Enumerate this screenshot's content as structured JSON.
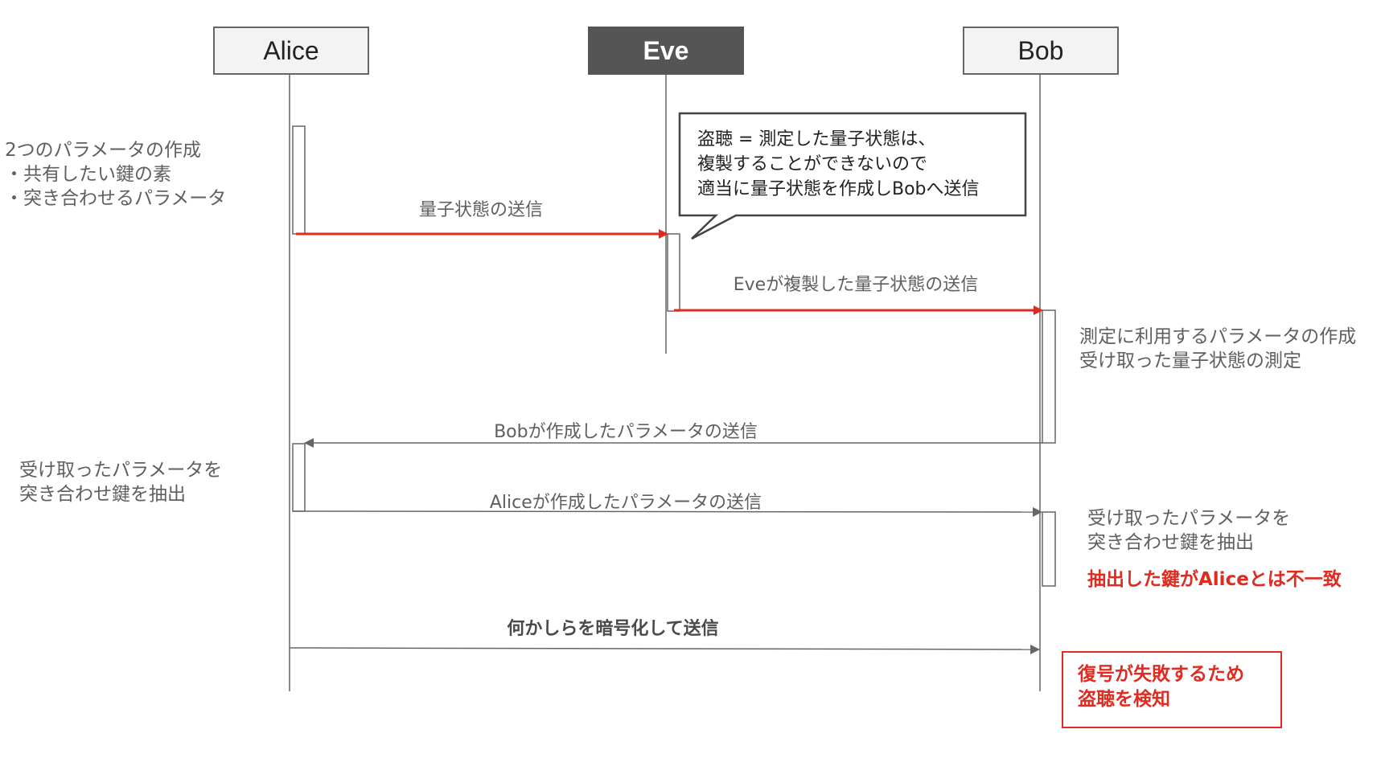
{
  "actors": {
    "alice": "Alice",
    "eve": "Eve",
    "bob": "Bob"
  },
  "messages": {
    "m1": "量子状態の送信",
    "m2": "Eveが複製した量子状態の送信",
    "m3": "Bobが作成したパラメータの送信",
    "m4": "Aliceが作成したパラメータの送信",
    "m5": "何かしらを暗号化して送信"
  },
  "notes": {
    "alice_create": "2つのパラメータの作成\n・共有したい鍵の素\n・突き合わせるパラメータ",
    "bob_measure": "測定に利用するパラメータの作成\n受け取った量子状態の測定",
    "alice_extract": "受け取ったパラメータを\n突き合わせ鍵を抽出",
    "bob_extract": "受け取ったパラメータを\n突き合わせ鍵を抽出",
    "bob_mismatch": "抽出した鍵がAliceとは不一致",
    "eve_callout": "盗聴 = 測定した量子状態は、\n複製することができないので\n適当に量子状態を作成しBobへ送信",
    "detect": "復号が失敗するため\n盗聴を検知"
  },
  "colors": {
    "red_arrow": "#e02b20",
    "gray_line": "#666666"
  }
}
